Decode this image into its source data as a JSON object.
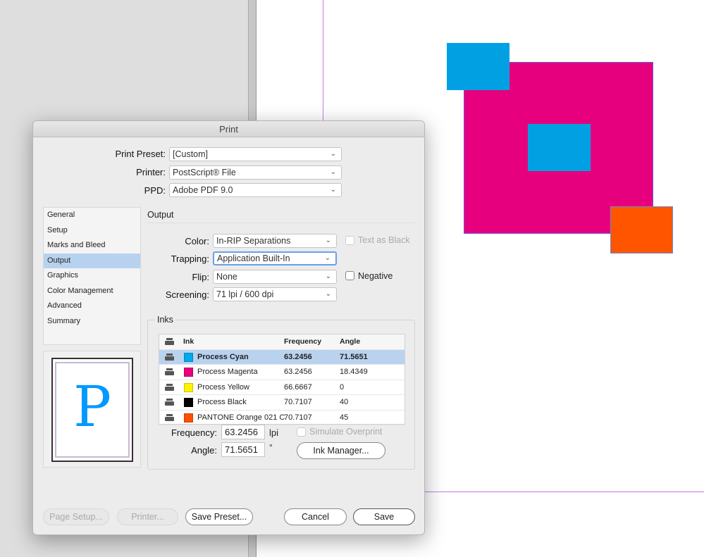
{
  "dialog": {
    "title": "Print",
    "print_preset": {
      "label": "Print Preset:",
      "value": "[Custom]"
    },
    "printer": {
      "label": "Printer:",
      "value": "PostScript® File"
    },
    "ppd": {
      "label": "PPD:",
      "value": "Adobe PDF 9.0"
    },
    "nav": [
      {
        "label": "General"
      },
      {
        "label": "Setup"
      },
      {
        "label": "Marks and Bleed"
      },
      {
        "label": "Output",
        "active": true
      },
      {
        "label": "Graphics"
      },
      {
        "label": "Color Management"
      },
      {
        "label": "Advanced"
      },
      {
        "label": "Summary"
      }
    ],
    "preview_letter": "P",
    "output": {
      "heading": "Output",
      "color": {
        "label": "Color:",
        "value": "In-RIP Separations"
      },
      "text_as_black": {
        "label": "Text as Black",
        "checked": false,
        "enabled": false
      },
      "trapping": {
        "label": "Trapping:",
        "value": "Application Built-In"
      },
      "flip": {
        "label": "Flip:",
        "value": "None"
      },
      "negative": {
        "label": "Negative",
        "checked": false
      },
      "screening": {
        "label": "Screening:",
        "value": "71 lpi / 600 dpi"
      }
    },
    "inks": {
      "heading": "Inks",
      "columns": [
        "Ink",
        "Frequency",
        "Angle"
      ],
      "rows": [
        {
          "name": "Process Cyan",
          "frequency": "63.2456",
          "angle": "71.5651",
          "color": "#00a8ec",
          "selected": true
        },
        {
          "name": "Process Magenta",
          "frequency": "63.2456",
          "angle": "18.4349",
          "color": "#e6007e"
        },
        {
          "name": "Process Yellow",
          "frequency": "66.6667",
          "angle": "0",
          "color": "#fff200"
        },
        {
          "name": "Process Black",
          "frequency": "70.7107",
          "angle": "40",
          "color": "#000000"
        },
        {
          "name": "PANTONE Orange 021 C",
          "frequency": "70.7107",
          "angle": "45",
          "color": "#fe5000"
        }
      ],
      "frequency": {
        "label": "Frequency:",
        "value": "63.2456",
        "unit": "lpi"
      },
      "angle": {
        "label": "Angle:",
        "value": "71.5651",
        "unit": "°"
      },
      "simulate_overprint": {
        "label": "Simulate Overprint",
        "checked": false,
        "enabled": false
      },
      "ink_manager": "Ink Manager..."
    },
    "buttons": {
      "page_setup": "Page Setup...",
      "printer": "Printer...",
      "save_preset": "Save Preset...",
      "cancel": "Cancel",
      "save": "Save"
    }
  },
  "canvas": {
    "colors": {
      "magenta": "#e6007e",
      "cyan": "#00a0e3",
      "orange": "#ff5500"
    }
  }
}
